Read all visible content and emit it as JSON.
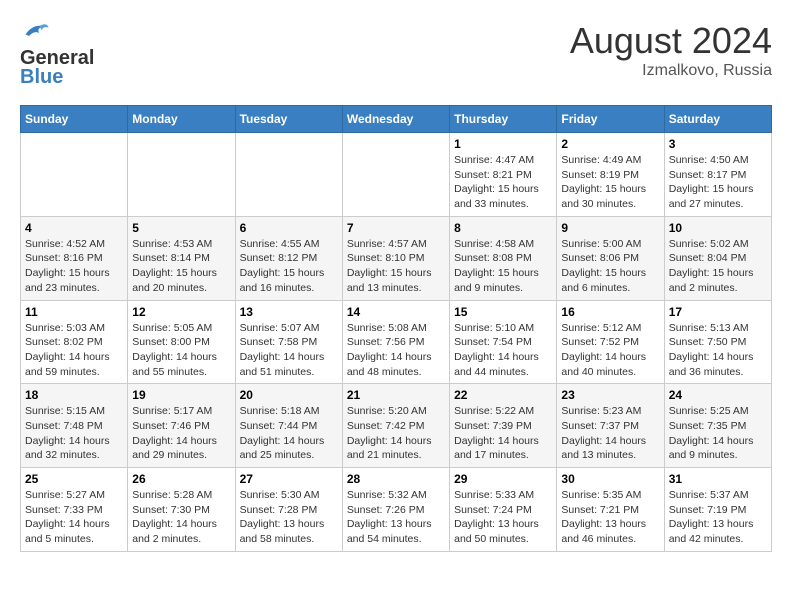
{
  "header": {
    "logo_line1": "General",
    "logo_line2": "Blue",
    "title": "August 2024",
    "subtitle": "Izmalkovo, Russia"
  },
  "weekdays": [
    "Sunday",
    "Monday",
    "Tuesday",
    "Wednesday",
    "Thursday",
    "Friday",
    "Saturday"
  ],
  "weeks": [
    [
      {
        "day": "",
        "info": ""
      },
      {
        "day": "",
        "info": ""
      },
      {
        "day": "",
        "info": ""
      },
      {
        "day": "",
        "info": ""
      },
      {
        "day": "1",
        "info": "Sunrise: 4:47 AM\nSunset: 8:21 PM\nDaylight: 15 hours\nand 33 minutes."
      },
      {
        "day": "2",
        "info": "Sunrise: 4:49 AM\nSunset: 8:19 PM\nDaylight: 15 hours\nand 30 minutes."
      },
      {
        "day": "3",
        "info": "Sunrise: 4:50 AM\nSunset: 8:17 PM\nDaylight: 15 hours\nand 27 minutes."
      }
    ],
    [
      {
        "day": "4",
        "info": "Sunrise: 4:52 AM\nSunset: 8:16 PM\nDaylight: 15 hours\nand 23 minutes."
      },
      {
        "day": "5",
        "info": "Sunrise: 4:53 AM\nSunset: 8:14 PM\nDaylight: 15 hours\nand 20 minutes."
      },
      {
        "day": "6",
        "info": "Sunrise: 4:55 AM\nSunset: 8:12 PM\nDaylight: 15 hours\nand 16 minutes."
      },
      {
        "day": "7",
        "info": "Sunrise: 4:57 AM\nSunset: 8:10 PM\nDaylight: 15 hours\nand 13 minutes."
      },
      {
        "day": "8",
        "info": "Sunrise: 4:58 AM\nSunset: 8:08 PM\nDaylight: 15 hours\nand 9 minutes."
      },
      {
        "day": "9",
        "info": "Sunrise: 5:00 AM\nSunset: 8:06 PM\nDaylight: 15 hours\nand 6 minutes."
      },
      {
        "day": "10",
        "info": "Sunrise: 5:02 AM\nSunset: 8:04 PM\nDaylight: 15 hours\nand 2 minutes."
      }
    ],
    [
      {
        "day": "11",
        "info": "Sunrise: 5:03 AM\nSunset: 8:02 PM\nDaylight: 14 hours\nand 59 minutes."
      },
      {
        "day": "12",
        "info": "Sunrise: 5:05 AM\nSunset: 8:00 PM\nDaylight: 14 hours\nand 55 minutes."
      },
      {
        "day": "13",
        "info": "Sunrise: 5:07 AM\nSunset: 7:58 PM\nDaylight: 14 hours\nand 51 minutes."
      },
      {
        "day": "14",
        "info": "Sunrise: 5:08 AM\nSunset: 7:56 PM\nDaylight: 14 hours\nand 48 minutes."
      },
      {
        "day": "15",
        "info": "Sunrise: 5:10 AM\nSunset: 7:54 PM\nDaylight: 14 hours\nand 44 minutes."
      },
      {
        "day": "16",
        "info": "Sunrise: 5:12 AM\nSunset: 7:52 PM\nDaylight: 14 hours\nand 40 minutes."
      },
      {
        "day": "17",
        "info": "Sunrise: 5:13 AM\nSunset: 7:50 PM\nDaylight: 14 hours\nand 36 minutes."
      }
    ],
    [
      {
        "day": "18",
        "info": "Sunrise: 5:15 AM\nSunset: 7:48 PM\nDaylight: 14 hours\nand 32 minutes."
      },
      {
        "day": "19",
        "info": "Sunrise: 5:17 AM\nSunset: 7:46 PM\nDaylight: 14 hours\nand 29 minutes."
      },
      {
        "day": "20",
        "info": "Sunrise: 5:18 AM\nSunset: 7:44 PM\nDaylight: 14 hours\nand 25 minutes."
      },
      {
        "day": "21",
        "info": "Sunrise: 5:20 AM\nSunset: 7:42 PM\nDaylight: 14 hours\nand 21 minutes."
      },
      {
        "day": "22",
        "info": "Sunrise: 5:22 AM\nSunset: 7:39 PM\nDaylight: 14 hours\nand 17 minutes."
      },
      {
        "day": "23",
        "info": "Sunrise: 5:23 AM\nSunset: 7:37 PM\nDaylight: 14 hours\nand 13 minutes."
      },
      {
        "day": "24",
        "info": "Sunrise: 5:25 AM\nSunset: 7:35 PM\nDaylight: 14 hours\nand 9 minutes."
      }
    ],
    [
      {
        "day": "25",
        "info": "Sunrise: 5:27 AM\nSunset: 7:33 PM\nDaylight: 14 hours\nand 5 minutes."
      },
      {
        "day": "26",
        "info": "Sunrise: 5:28 AM\nSunset: 7:30 PM\nDaylight: 14 hours\nand 2 minutes."
      },
      {
        "day": "27",
        "info": "Sunrise: 5:30 AM\nSunset: 7:28 PM\nDaylight: 13 hours\nand 58 minutes."
      },
      {
        "day": "28",
        "info": "Sunrise: 5:32 AM\nSunset: 7:26 PM\nDaylight: 13 hours\nand 54 minutes."
      },
      {
        "day": "29",
        "info": "Sunrise: 5:33 AM\nSunset: 7:24 PM\nDaylight: 13 hours\nand 50 minutes."
      },
      {
        "day": "30",
        "info": "Sunrise: 5:35 AM\nSunset: 7:21 PM\nDaylight: 13 hours\nand 46 minutes."
      },
      {
        "day": "31",
        "info": "Sunrise: 5:37 AM\nSunset: 7:19 PM\nDaylight: 13 hours\nand 42 minutes."
      }
    ]
  ]
}
